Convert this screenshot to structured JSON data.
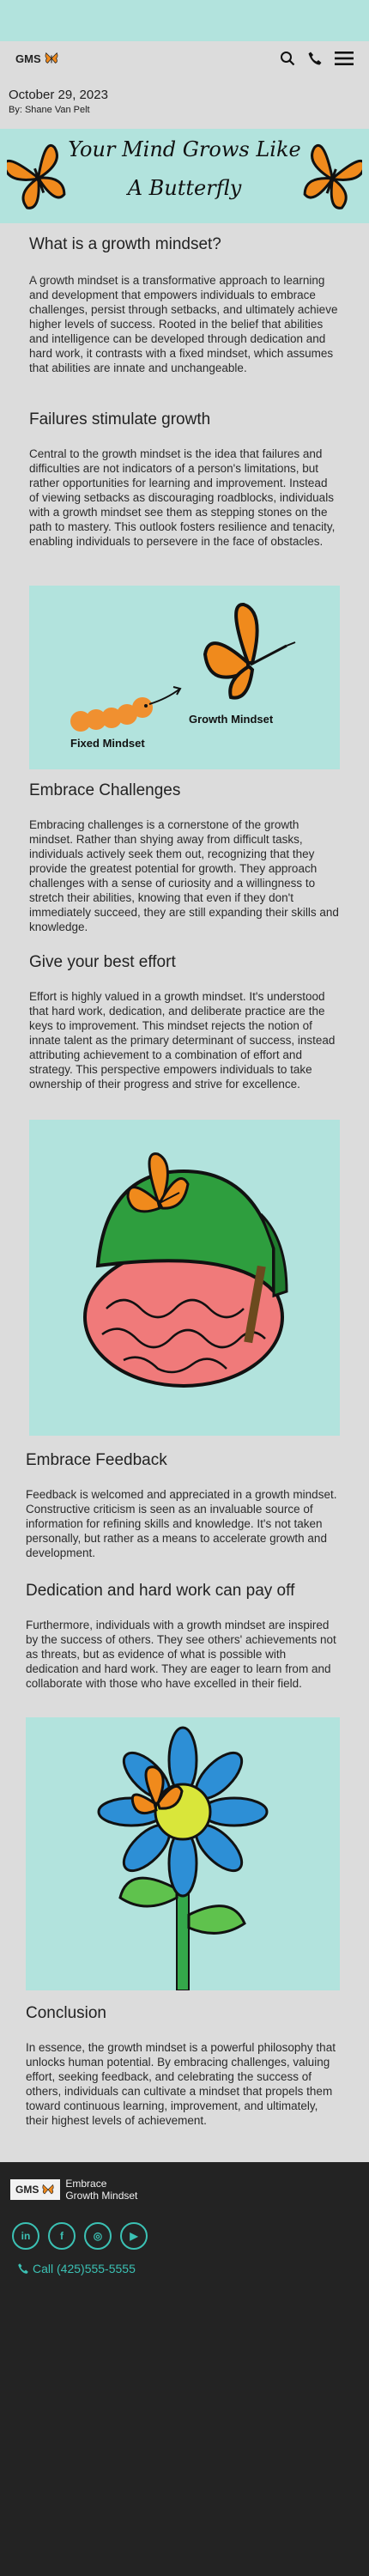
{
  "header": {
    "logo_text": "GMS",
    "icons": [
      "search-icon",
      "phone-icon",
      "menu-icon"
    ]
  },
  "meta": {
    "date": "October 29, 2023",
    "author": "By: Shane Van Pelt"
  },
  "hero": {
    "line1": "Your Mind Grows Like",
    "line2": "A Butterfly"
  },
  "sections": [
    {
      "heading": "What is a growth mindset?",
      "body": "A growth mindset is a transformative approach to learning and development that empowers individuals to embrace challenges, persist through setbacks, and ultimately achieve higher levels of success. Rooted in the belief that abilities and intelligence can be developed through dedication and hard work, it contrasts with a fixed mindset, which assumes that abilities are innate and unchangeable."
    },
    {
      "heading": "Failures stimulate growth",
      "body": "Central to the growth mindset is the idea that failures and difficulties are not indicators of a person's limitations, but rather opportunities for learning and improvement. Instead of viewing setbacks as discouraging roadblocks, individuals with a growth mindset see them as stepping stones on the path to mastery. This outlook fosters resilience and tenacity, enabling individuals to persevere in the face of obstacles."
    },
    {
      "heading": "Embrace Challenges",
      "body": "Embracing challenges is a cornerstone of the growth mindset. Rather than shying away from difficult tasks, individuals actively seek them out, recognizing that they provide the greatest potential for growth. They approach challenges with a sense of curiosity and a willingness to stretch their abilities, knowing that even if they don't immediately succeed, they are still expanding their skills and knowledge."
    },
    {
      "heading": "Give your best effort",
      "body": "Effort is highly valued in a growth mindset. It's understood that hard work, dedication, and deliberate practice are the keys to improvement. This mindset rejects the notion of innate talent as the primary determinant of success, instead attributing achievement to a combination of effort and strategy. This perspective empowers individuals to take ownership of their progress and strive for excellence."
    },
    {
      "heading": "Embrace Feedback",
      "body": "Feedback is welcomed and appreciated in a growth mindset. Constructive criticism is seen as an invaluable source of information for refining skills and knowledge. It's not taken personally, but rather as a means to accelerate growth and development."
    },
    {
      "heading": "Dedication and hard work can pay off",
      "body": "Furthermore, individuals with a growth mindset are inspired by the success of others. They see others' achievements not as threats, but as evidence of what is possible with dedication and hard work. They are eager to learn from and collaborate with those who have excelled in their field."
    },
    {
      "heading": "Conclusion",
      "body": "In essence, the growth mindset is a powerful philosophy that unlocks human potential. By embracing challenges, valuing effort, seeking feedback, and celebrating the success of others, individuals can cultivate a mindset that propels them toward continuous learning, improvement, and ultimately, their highest levels of achievement."
    }
  ],
  "illustration1": {
    "fixed_label": "Fixed Mindset",
    "growth_label": "Growth Mindset"
  },
  "footer": {
    "logo_text": "GMS",
    "tagline_line1": "Embrace",
    "tagline_line2": "Growth Mindset",
    "social": [
      "in",
      "f",
      "◎",
      "▶"
    ],
    "social_icons": [
      "linkedin-icon",
      "facebook-icon",
      "instagram-icon",
      "youtube-icon"
    ],
    "call": "Call (425)555-5555"
  },
  "colors": {
    "accent_teal": "#b2e3dd",
    "footer_bg": "#232323",
    "footer_accent": "#3bc1b4",
    "butterfly_orange": "#f08a1c"
  }
}
